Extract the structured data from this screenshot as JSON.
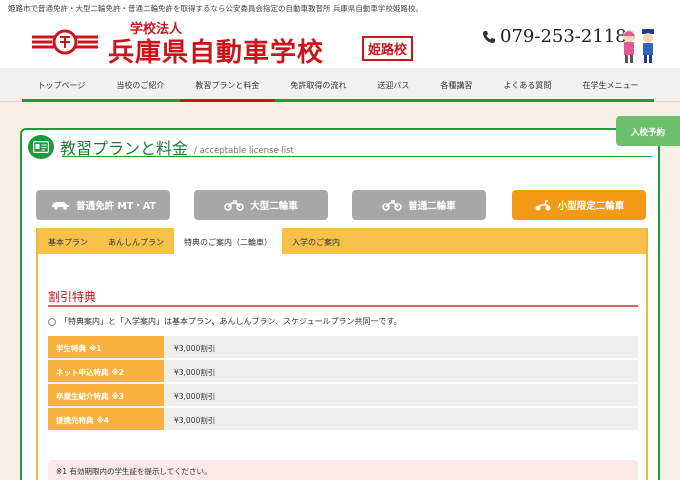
{
  "topbar": {
    "text": "姫路市で普通免許・大型二輪免許・普通二輪免許を取得するなら公安委員会指定の自動車教習所 兵庫県自動車学校姫路校。"
  },
  "header": {
    "corp": "学校法人",
    "school": "兵庫県自動車学校",
    "branch": "姫路校",
    "phone": "079-253-2118",
    "brand_color": "#c8161d"
  },
  "nav": {
    "items": [
      {
        "label": "トップページ"
      },
      {
        "label": "当校のご紹介"
      },
      {
        "label": "教習プランと料金"
      },
      {
        "label": "免許取得の流れ"
      },
      {
        "label": "送迎バス"
      },
      {
        "label": "各種講習"
      },
      {
        "label": "よくある質問"
      },
      {
        "label": "在学生メニュー"
      }
    ],
    "active_index": 2
  },
  "reserve": {
    "label": "入校予約"
  },
  "card": {
    "title_ja": "教習プランと料金",
    "title_en": "/ acceptable license list",
    "accent": "#1e9a3c"
  },
  "licenses": [
    {
      "label": "普通免許 MT・AT",
      "icon": "car-icon"
    },
    {
      "label": "大型二輪車",
      "icon": "motorcycle-icon"
    },
    {
      "label": "普通二輪車",
      "icon": "motorcycle-icon"
    },
    {
      "label": "小型限定二輪車",
      "icon": "scooter-icon",
      "active": true
    }
  ],
  "tabs": [
    {
      "label": "基本プラン"
    },
    {
      "label": "あんしんプラン"
    },
    {
      "label": "特典のご案内（二輪車）",
      "active": true
    },
    {
      "label": "入学のご案内"
    }
  ],
  "section": {
    "title": "割引特典",
    "note": "「特典案内」と「入学案内」は基本プラン、あんしんプラン、スケジュールプラン共同一です。"
  },
  "discounts": [
    {
      "name": "学生特典",
      "mark": "※1",
      "value": "¥3,000割引"
    },
    {
      "name": "ネット申込特典",
      "mark": "※2",
      "value": "¥3,000割引"
    },
    {
      "name": "卒業生紹介特典",
      "mark": "※3",
      "value": "¥3,000割引"
    },
    {
      "name": "提携先特典",
      "mark": "※4",
      "value": "¥3,000割引"
    }
  ],
  "footnotes": [
    "※1 有効期限内の学生証を提示してください。"
  ]
}
